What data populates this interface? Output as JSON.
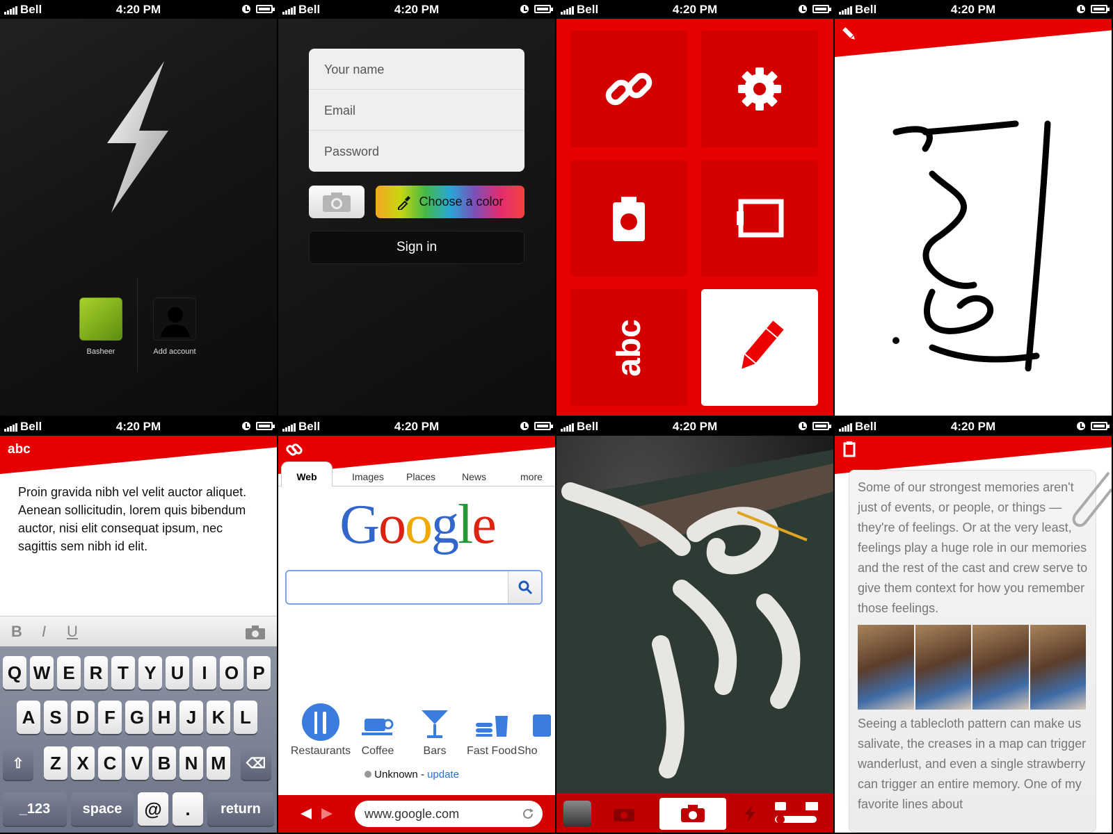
{
  "status": {
    "carrier": "Bell",
    "time": "4:20 PM"
  },
  "login": {
    "accounts": [
      {
        "name": "Basheer"
      },
      {
        "name": "Add account"
      }
    ]
  },
  "signup": {
    "name_placeholder": "Your name",
    "email_placeholder": "Email",
    "password_placeholder": "Password",
    "color_label": "Choose a color",
    "signin_label": "Sign in"
  },
  "menu": {
    "tiles": [
      "link-icon",
      "gear-icon",
      "camera-icon",
      "clipboard-icon",
      "text-icon",
      "pencil-icon"
    ],
    "text_tile": "abc"
  },
  "draw": {
    "handwriting": "idea"
  },
  "text_note": {
    "title": "abc",
    "body": "Proin gravida nibh vel velit auctor aliquet. Aenean sollicitudin, lorem quis bibendum auctor, nisi elit consequat ipsum, nec sagittis sem nibh id elit.",
    "format": [
      "B",
      "I",
      "U"
    ],
    "keys_row1": [
      "Q",
      "W",
      "E",
      "R",
      "T",
      "Y",
      "U",
      "I",
      "O",
      "P"
    ],
    "keys_row2": [
      "A",
      "S",
      "D",
      "F",
      "G",
      "H",
      "J",
      "K",
      "L"
    ],
    "keys_row3": [
      "Z",
      "X",
      "C",
      "V",
      "B",
      "N",
      "M"
    ],
    "key_123": ".?123",
    "key_123_display": "_123",
    "key_space": "space",
    "key_at": "@",
    "key_dot": ".",
    "key_return": "return"
  },
  "browser": {
    "tabs": [
      "Web",
      "Images",
      "Places",
      "News",
      "more"
    ],
    "logo": "Google",
    "categories": [
      "Restaurants",
      "Coffee",
      "Bars",
      "Fast Food",
      "Sho"
    ],
    "location": "Unknown",
    "location_sep": " - ",
    "update": "update",
    "url": "www.google.com"
  },
  "article": {
    "para1": "Some of our strongest memories aren't just of events, or people, or things — they're of feelings. Or at the very least, feelings play a huge role in our memories and the rest of the cast and crew serve to give them context for how you remember those feelings.",
    "para2": "Seeing a tablecloth pattern can make us salivate, the creases in a map can trigger wanderlust, and even a single strawberry can trigger an entire memory. One of my favorite lines about"
  },
  "colors": {
    "red": "#e60000",
    "dark": "#111111",
    "blue_link": "#2a6fd6"
  }
}
